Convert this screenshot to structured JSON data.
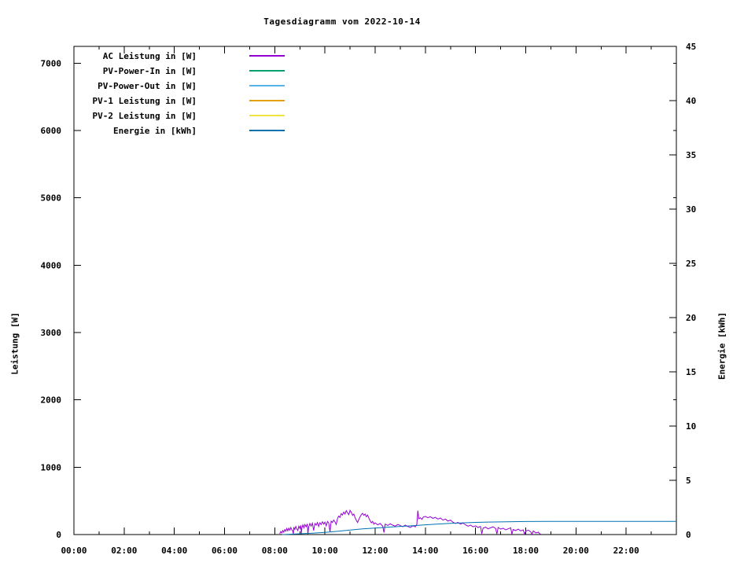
{
  "chart_data": {
    "type": "line",
    "title": "Tagesdiagramm vom 2022-10-14",
    "background": "#ffffff",
    "grid": false,
    "x_axis": {
      "label": "",
      "min_hours": 0,
      "max_hours": 24,
      "minor_tick_hours": 1,
      "major_tick_hours": 2,
      "tick_labels": [
        "00:00",
        "02:00",
        "04:00",
        "06:00",
        "08:00",
        "10:00",
        "12:00",
        "14:00",
        "16:00",
        "18:00",
        "20:00",
        "22:00"
      ]
    },
    "y_axis_left": {
      "label": "Leistung [W]",
      "min": 0,
      "max": 7250,
      "ticks": [
        0,
        1000,
        2000,
        3000,
        4000,
        5000,
        6000,
        7000
      ],
      "tick_labels": [
        "0",
        "1000",
        "2000",
        "3000",
        "4000",
        "5000",
        "6000",
        "7000"
      ]
    },
    "y_axis_right": {
      "label": "Energie [kWh]",
      "min": 0,
      "max": 45,
      "ticks": [
        0,
        5,
        10,
        15,
        20,
        25,
        30,
        35,
        40,
        45
      ],
      "tick_labels": [
        "0",
        "5",
        "10",
        "15",
        "20",
        "25",
        "30",
        "35",
        "40",
        "45"
      ]
    },
    "legend": {
      "position": "top-left",
      "entries": [
        "AC Leistung in [W]",
        "PV-Power-In in [W]",
        "PV-Power-Out in [W]",
        "PV-1 Leistung in [W]",
        "PV-2 Leistung in [W]",
        "Energie in [kWh]"
      ]
    },
    "series": [
      {
        "name": "AC Leistung in [W]",
        "color": "#9400d3",
        "axis": "left",
        "points": [
          [
            8.2,
            10
          ],
          [
            8.24,
            45
          ],
          [
            8.28,
            25
          ],
          [
            8.32,
            60
          ],
          [
            8.36,
            35
          ],
          [
            8.4,
            75
          ],
          [
            8.44,
            50
          ],
          [
            8.48,
            90
          ],
          [
            8.52,
            55
          ],
          [
            8.56,
            95
          ],
          [
            8.6,
            65
          ],
          [
            8.64,
            105
          ],
          [
            8.68,
            70
          ],
          [
            8.72,
            55
          ],
          [
            8.74,
            5
          ],
          [
            8.76,
            110
          ],
          [
            8.8,
            75
          ],
          [
            8.84,
            120
          ],
          [
            8.88,
            85
          ],
          [
            8.92,
            60
          ],
          [
            8.96,
            125
          ],
          [
            9.0,
            90
          ],
          [
            9.04,
            135
          ],
          [
            9.06,
            8
          ],
          [
            9.08,
            95
          ],
          [
            9.12,
            145
          ],
          [
            9.16,
            100
          ],
          [
            9.2,
            150
          ],
          [
            9.25,
            115
          ],
          [
            9.3,
            160
          ],
          [
            9.32,
            6
          ],
          [
            9.35,
            105
          ],
          [
            9.4,
            165
          ],
          [
            9.45,
            125
          ],
          [
            9.5,
            170
          ],
          [
            9.55,
            60
          ],
          [
            9.6,
            165
          ],
          [
            9.65,
            140
          ],
          [
            9.7,
            180
          ],
          [
            9.75,
            120
          ],
          [
            9.8,
            175
          ],
          [
            9.85,
            150
          ],
          [
            9.9,
            190
          ],
          [
            9.95,
            155
          ],
          [
            10.0,
            185
          ],
          [
            10.05,
            130
          ],
          [
            10.1,
            195
          ],
          [
            10.15,
            170
          ],
          [
            10.2,
            40
          ],
          [
            10.25,
            200
          ],
          [
            10.3,
            180
          ],
          [
            10.35,
            215
          ],
          [
            10.4,
            190
          ],
          [
            10.45,
            150
          ],
          [
            10.5,
            235
          ],
          [
            10.55,
            275
          ],
          [
            10.6,
            255
          ],
          [
            10.65,
            310
          ],
          [
            10.7,
            290
          ],
          [
            10.75,
            335
          ],
          [
            10.8,
            305
          ],
          [
            10.85,
            355
          ],
          [
            10.9,
            325
          ],
          [
            10.95,
            295
          ],
          [
            11.0,
            360
          ],
          [
            11.05,
            330
          ],
          [
            11.1,
            285
          ],
          [
            11.15,
            305
          ],
          [
            11.2,
            250
          ],
          [
            11.25,
            210
          ],
          [
            11.3,
            180
          ],
          [
            11.35,
            225
          ],
          [
            11.4,
            265
          ],
          [
            11.45,
            295
          ],
          [
            11.5,
            315
          ],
          [
            11.55,
            285
          ],
          [
            11.6,
            305
          ],
          [
            11.65,
            265
          ],
          [
            11.7,
            290
          ],
          [
            11.75,
            245
          ],
          [
            11.8,
            205
          ],
          [
            11.85,
            175
          ],
          [
            11.9,
            195
          ],
          [
            11.95,
            155
          ],
          [
            12.0,
            175
          ],
          [
            12.1,
            145
          ],
          [
            12.2,
            165
          ],
          [
            12.3,
            125
          ],
          [
            12.35,
            30
          ],
          [
            12.4,
            155
          ],
          [
            12.5,
            135
          ],
          [
            12.6,
            160
          ],
          [
            12.7,
            140
          ],
          [
            12.8,
            125
          ],
          [
            12.9,
            150
          ],
          [
            13.0,
            135
          ],
          [
            13.1,
            115
          ],
          [
            13.2,
            140
          ],
          [
            13.3,
            120
          ],
          [
            13.4,
            105
          ],
          [
            13.5,
            130
          ],
          [
            13.6,
            115
          ],
          [
            13.66,
            150
          ],
          [
            13.7,
            355
          ],
          [
            13.74,
            235
          ],
          [
            13.8,
            250
          ],
          [
            13.86,
            225
          ],
          [
            13.92,
            260
          ],
          [
            14.0,
            270
          ],
          [
            14.1,
            250
          ],
          [
            14.2,
            265
          ],
          [
            14.3,
            240
          ],
          [
            14.4,
            255
          ],
          [
            14.5,
            230
          ],
          [
            14.6,
            245
          ],
          [
            14.7,
            215
          ],
          [
            14.8,
            230
          ],
          [
            14.9,
            200
          ],
          [
            15.0,
            215
          ],
          [
            15.1,
            185
          ],
          [
            15.2,
            165
          ],
          [
            15.3,
            180
          ],
          [
            15.4,
            155
          ],
          [
            15.5,
            170
          ],
          [
            15.6,
            145
          ],
          [
            15.7,
            125
          ],
          [
            15.8,
            140
          ],
          [
            15.9,
            115
          ],
          [
            16.0,
            130
          ],
          [
            16.1,
            105
          ],
          [
            16.2,
            120
          ],
          [
            16.25,
            10
          ],
          [
            16.3,
            95
          ],
          [
            16.4,
            110
          ],
          [
            16.5,
            85
          ],
          [
            16.6,
            100
          ],
          [
            16.7,
            115
          ],
          [
            16.8,
            90
          ],
          [
            16.85,
            8
          ],
          [
            16.9,
            105
          ],
          [
            17.0,
            80
          ],
          [
            17.1,
            95
          ],
          [
            17.2,
            70
          ],
          [
            17.3,
            85
          ],
          [
            17.4,
            100
          ],
          [
            17.45,
            5
          ],
          [
            17.5,
            75
          ],
          [
            17.6,
            60
          ],
          [
            17.7,
            80
          ],
          [
            17.8,
            55
          ],
          [
            17.9,
            70
          ],
          [
            17.95,
            6
          ],
          [
            18.0,
            50
          ],
          [
            18.1,
            65
          ],
          [
            18.2,
            40
          ],
          [
            18.25,
            4
          ],
          [
            18.3,
            55
          ],
          [
            18.4,
            25
          ],
          [
            18.5,
            35
          ],
          [
            18.56,
            10
          ],
          [
            18.62,
            0
          ]
        ]
      },
      {
        "name": "PV-Power-In in [W]",
        "color": "#009e73",
        "axis": "left",
        "points": []
      },
      {
        "name": "PV-Power-Out in [W]",
        "color": "#56b4e9",
        "axis": "left",
        "points": []
      },
      {
        "name": "PV-1 Leistung in [W]",
        "color": "#e69f00",
        "axis": "left",
        "points": []
      },
      {
        "name": "PV-2 Leistung in [W]",
        "color": "#f0e442",
        "axis": "left",
        "points": []
      },
      {
        "name": "Energie in [kWh]",
        "color": "#0072b2",
        "axis": "right",
        "points": [
          [
            8.3,
            0
          ],
          [
            8.6,
            0.03
          ],
          [
            9.0,
            0.07
          ],
          [
            9.5,
            0.13
          ],
          [
            10.0,
            0.2
          ],
          [
            10.5,
            0.3
          ],
          [
            11.0,
            0.42
          ],
          [
            11.5,
            0.52
          ],
          [
            12.0,
            0.6
          ],
          [
            12.5,
            0.68
          ],
          [
            13.0,
            0.75
          ],
          [
            13.5,
            0.82
          ],
          [
            14.0,
            0.9
          ],
          [
            14.5,
            0.97
          ],
          [
            15.0,
            1.03
          ],
          [
            15.5,
            1.08
          ],
          [
            16.0,
            1.12
          ],
          [
            16.5,
            1.15
          ],
          [
            17.0,
            1.17
          ],
          [
            17.5,
            1.19
          ],
          [
            18.0,
            1.2
          ],
          [
            19.0,
            1.21
          ],
          [
            24.0,
            1.21
          ]
        ]
      }
    ]
  }
}
